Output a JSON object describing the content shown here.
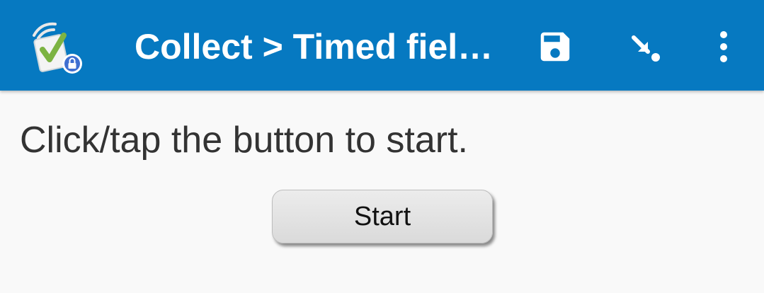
{
  "toolbar": {
    "title": "Collect > Timed fiel…",
    "icons": {
      "app": "odk-collect-app-icon",
      "save": "save-icon",
      "jump": "go-to-prompt-icon",
      "menu": "more-vert-icon"
    },
    "colors": {
      "background": "#0679c1",
      "text": "#ffffff"
    }
  },
  "main": {
    "prompt": "Click/tap the button to start.",
    "start_button_label": "Start"
  }
}
